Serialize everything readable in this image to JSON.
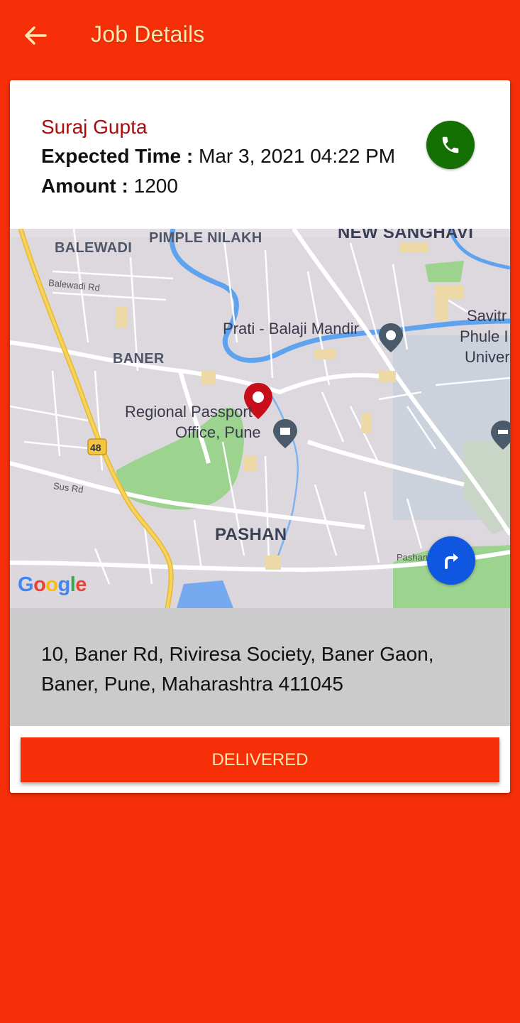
{
  "header": {
    "title": "Job Details",
    "back_icon": "arrow-left-icon"
  },
  "job": {
    "customer_name": "Suraj Gupta",
    "expected_time_label": "Expected Time :",
    "expected_time_value": "Mar 3, 2021 04:22 PM",
    "amount_label": "Amount :",
    "amount_value": "1200",
    "call_icon": "phone-icon"
  },
  "map": {
    "labels": {
      "balewadi": "BALEWADI",
      "pimple_nilakh": "PIMPLE NILAKH",
      "new_sanghavi": "NEW SANGHAVI",
      "balewadi_rd": "Balewadi Rd",
      "prati_balaji": "Prati - Balaji Mandir",
      "savitri_1": "Savitr",
      "savitri_2": "Phule I",
      "savitri_3": "Univer",
      "baner": "BANER",
      "passport_1": "Regional Passport",
      "passport_2": "Office, Pune",
      "highway": "48",
      "sus_rd": "Sus Rd",
      "pashan": "PASHAN",
      "pashan_rd": "Pashan"
    },
    "logo": "Google",
    "directions_icon": "directions-icon",
    "pin_icon": "location-pin-icon"
  },
  "address": "10, Baner Rd, Riviresa Society, Baner Gaon, Baner, Pune, Maharashtra 411045",
  "actions": {
    "delivered_label": "DELIVERED"
  },
  "colors": {
    "brand": "#f72f08",
    "title_text": "#fde7b0",
    "customer_name": "#a80d0d",
    "call_button": "#157003",
    "directions_button": "#0f56e0",
    "address_background": "#cbcbcb"
  }
}
